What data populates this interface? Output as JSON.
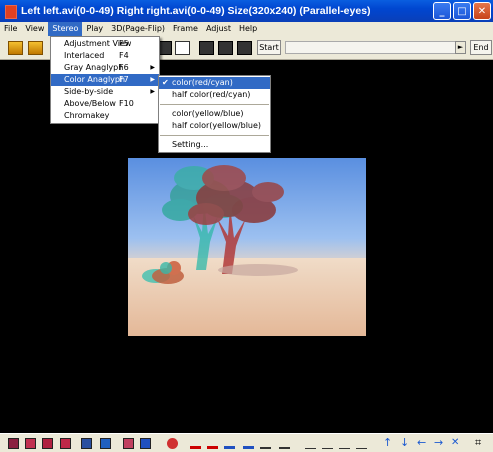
{
  "window": {
    "title": "Left left.avi(0-0-49) Right right.avi(0-0-49) Size(320x240)  (Parallel-eyes)",
    "minimize": "_",
    "maximize": "□",
    "close": "✕"
  },
  "menubar": [
    "File",
    "View",
    "Stereo",
    "Play",
    "3D(Page-Flip)",
    "Frame",
    "Adjust",
    "Help"
  ],
  "toolbar": {
    "start_label": "Start",
    "end_label": "End",
    "left_arrow": "◄",
    "right_arrow": "►"
  },
  "stereo_menu": [
    {
      "label": "Adjustment View",
      "accel": "F5",
      "submenu": false
    },
    {
      "label": "Interlaced",
      "accel": "F4",
      "submenu": false
    },
    {
      "label": "Gray Anaglyph",
      "accel": "F6",
      "submenu": true
    },
    {
      "label": "Color Anaglyph",
      "accel": "F7",
      "submenu": true
    },
    {
      "label": "Side-by-side",
      "accel": "",
      "submenu": true
    },
    {
      "label": "Above/Below",
      "accel": "F10",
      "submenu": false
    },
    {
      "label": "Chromakey",
      "accel": "",
      "submenu": false
    }
  ],
  "submenu_arrow": "▶",
  "color_anaglyph_menu": [
    {
      "label": "color(red/cyan)",
      "checked": true
    },
    {
      "label": "half color(red/cyan)",
      "checked": false
    },
    {
      "label": "color(yellow/blue)",
      "checked": false
    },
    {
      "label": "half color(yellow/blue)",
      "checked": false
    },
    {
      "label": "Setting...",
      "checked": false
    }
  ],
  "check_mark": "✔",
  "colors": {
    "titlebar": "#0046d0",
    "menu_bg": "#ece9d8",
    "highlight": "#316ac5",
    "viewport": "#000000"
  }
}
